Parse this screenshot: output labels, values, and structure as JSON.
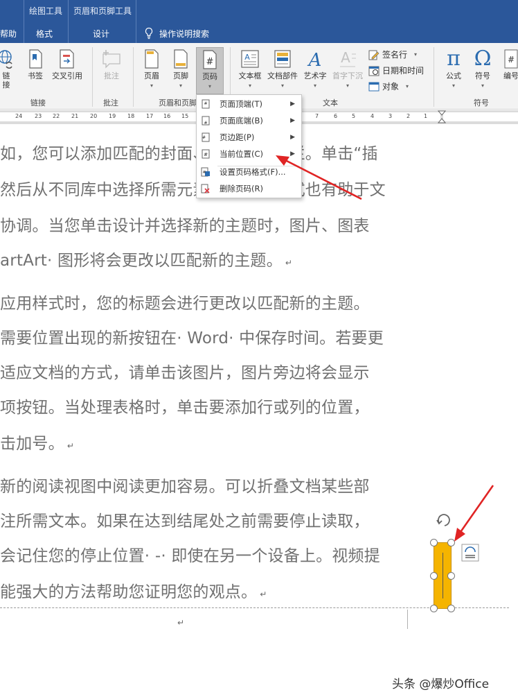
{
  "tabs_bar": {
    "context_labels": [
      "绘图工具",
      "页眉和页脚工具"
    ],
    "tabs": [
      "帮助",
      "格式",
      "设计"
    ],
    "search_label": "操作说明搜索",
    "accent": "#2b579a"
  },
  "ribbon": {
    "buttons": {
      "link": "链接",
      "bookmark": "书签",
      "cross_ref": "交叉引用",
      "comment": "批注",
      "header": "页眉",
      "footer": "页脚",
      "page_number": "页码",
      "textbox": "文本框",
      "quick_parts": "文档部件",
      "wordart": "艺术字",
      "dropcap": "首字下沉",
      "signature": "签名行",
      "datetime": "日期和时间",
      "object": "对象",
      "equation": "公式",
      "symbol": "符号",
      "numbering": "编号"
    },
    "groups": {
      "links": "链接",
      "comments": "批注",
      "header_footer": "页眉和页脚",
      "text": "文本",
      "symbols": "符号"
    }
  },
  "ruler": {
    "left_numbers": [
      "24",
      "23",
      "22",
      "21",
      "20",
      "19",
      "18",
      "17",
      "16",
      "15",
      "14"
    ],
    "right_numbers": [
      "7",
      "6",
      "5",
      "4",
      "3",
      "2",
      "1"
    ]
  },
  "page_number_menu": {
    "items": [
      {
        "label": "页面顶端(T)",
        "icon": "page-top-icon",
        "has_submenu": true
      },
      {
        "label": "页面底端(B)",
        "icon": "page-bottom-icon",
        "has_submenu": true
      },
      {
        "label": "页边距(P)",
        "icon": "page-margin-icon",
        "has_submenu": true
      },
      {
        "label": "当前位置(C)",
        "icon": "current-position-icon",
        "has_submenu": true
      },
      {
        "label": "设置页码格式(F)...",
        "icon": "format-page-number-icon",
        "has_submenu": false
      },
      {
        "label": "删除页码(R)",
        "icon": "remove-page-number-icon",
        "has_submenu": false
      }
    ]
  },
  "document": {
    "lines": [
      "如，您可以添加匹配的封面、页眉和提要栏。单击“插",
      "然后从不同库中选择所需元素。主题和样式也有助于文",
      "协调。当您单击设计并选择新的主题时，图片、图表",
      "artArt· 图形将会更改以匹配新的主题。",
      "应用样式时，您的标题会进行更改以匹配新的主题。",
      "需要位置出现的新按钮在· Word· 中保存时间。若要更",
      "适应文档的方式，请单击该图片，图片旁边将会显示",
      "项按钮。当处理表格时，单击要添加行或列的位置，",
      "击加号。",
      "新的阅读视图中阅读更加容易。可以折叠文档某些部",
      "注所需文本。如果在达到结尾处之前需要停止读取，",
      "会记住您的停止位置· -· 即使在另一个设备上。视频提",
      "能强大的方法帮助您证明您的观点。"
    ],
    "paragraph_end_lines": [
      3,
      8,
      12
    ],
    "paragraph_mark": "↵",
    "textbox_color": "#f5b400",
    "arrow_color": "#e02424"
  },
  "watermark": "头条 @爆炒Office"
}
